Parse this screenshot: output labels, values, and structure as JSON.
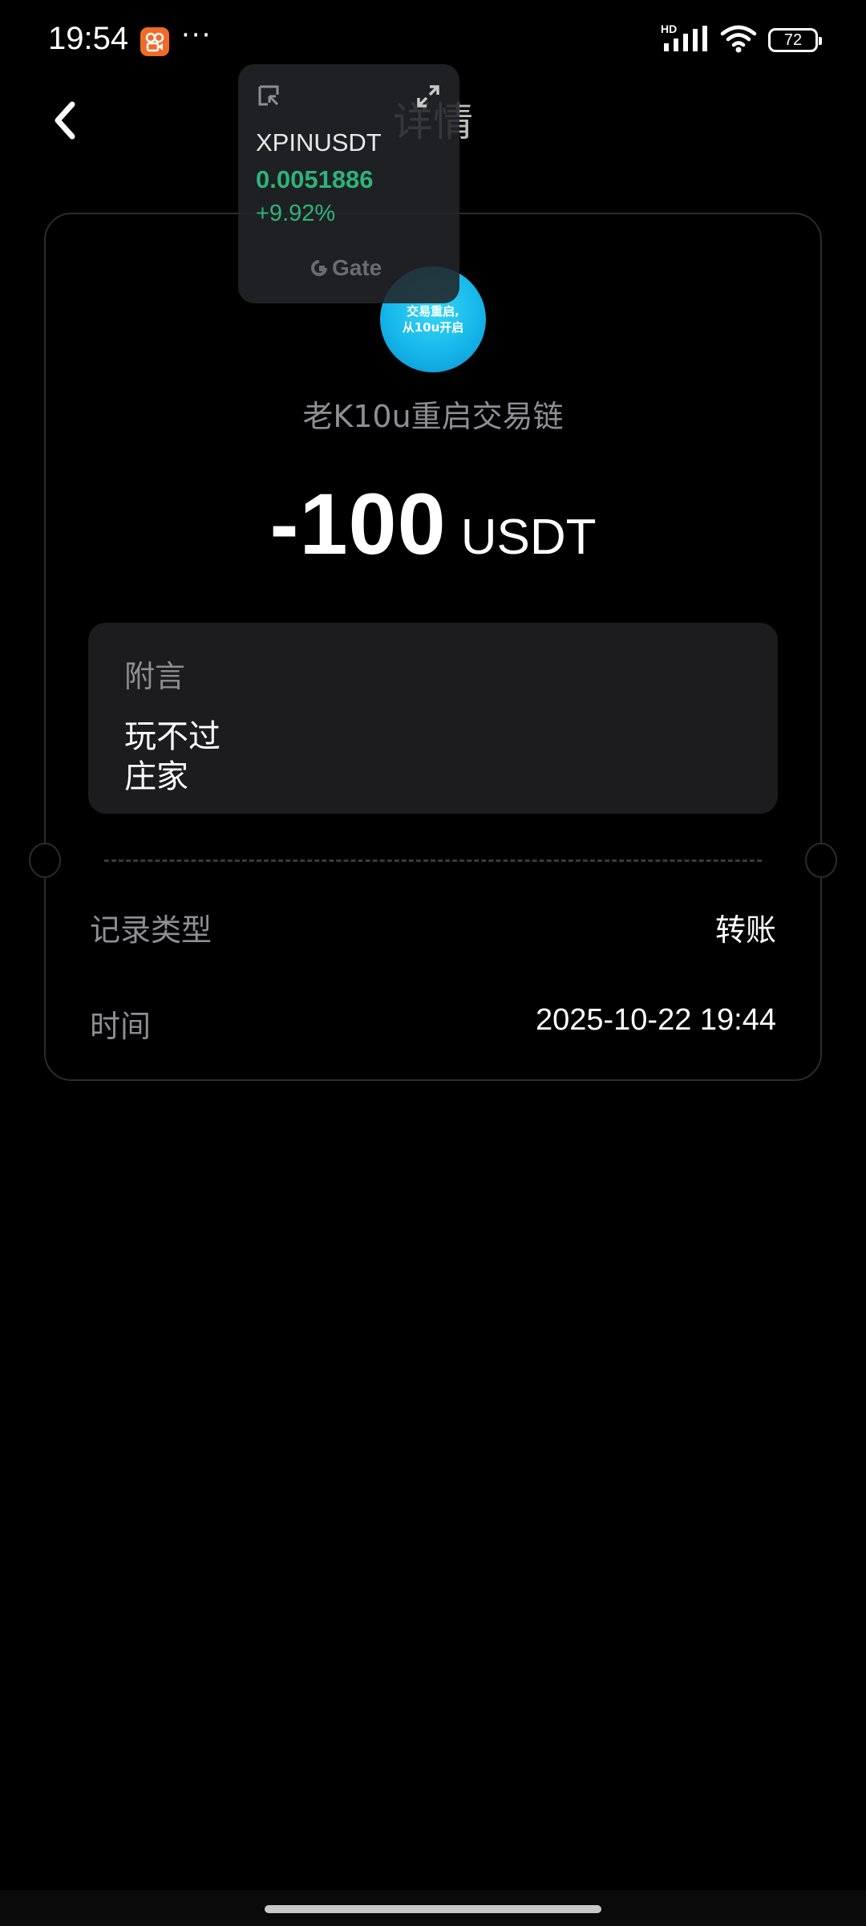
{
  "status_bar": {
    "time": "19:54",
    "more_dots": "···",
    "network_label": "HD",
    "battery": "72",
    "app_icon": "kuaishou-icon"
  },
  "header": {
    "title": "详情",
    "back_icon": "chevron-left-icon"
  },
  "detail": {
    "avatar_line1": "交易重启,",
    "avatar_line2": "从10u开启",
    "chain_name": "老K10u重启交易链",
    "amount": "-100",
    "unit": "USDT",
    "memo_label": "附言",
    "memo_line1": "玩不过",
    "memo_line2": "庄家",
    "rows": [
      {
        "label": "记录类型",
        "value": "转账"
      },
      {
        "label": "时间",
        "value": "2025-10-22 19:44"
      }
    ]
  },
  "ticker": {
    "symbol": "XPINUSDT",
    "price": "0.0051886",
    "change": "+9.92%",
    "brand": "Gate",
    "up_color": "#2eb37a"
  }
}
